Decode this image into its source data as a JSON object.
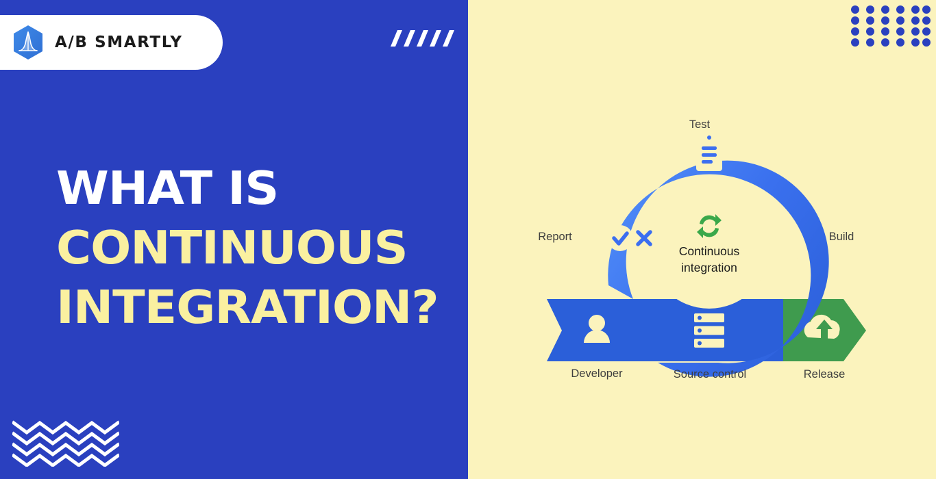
{
  "brand": {
    "name": "A/B SMARTLY",
    "logo_icon": "hexagon-bell-curve-icon",
    "accent_blue": "#2a40bf",
    "accent_yellow": "#faf0a0",
    "panel_cream": "#fbf3bd"
  },
  "decor": {
    "slashes_icon": "diagonal-slashes-decoration",
    "slashes_count": 5,
    "waves_icon": "zigzag-waves-decoration",
    "waves_count": 4,
    "dot_grid_icon": "dot-grid-decoration",
    "dot_grid_cols": 6,
    "dot_grid_rows": 4,
    "dot_color": "#2a40bf"
  },
  "headline": {
    "line1": "WHAT IS",
    "line2": "CONTINUOUS",
    "line3": "INTEGRATION?"
  },
  "diagram": {
    "center_line1": "Continuous",
    "center_line2": "integration",
    "center_icon": "refresh-cycle-icon",
    "center_icon_color": "#3aa84a",
    "stages": [
      {
        "label": "Test",
        "icon": "clipboard-icon",
        "color": "#3b6ef0"
      },
      {
        "label": "Build",
        "icon": "wrench-icon",
        "color": "#2a5fe0"
      },
      {
        "label": "Report",
        "icon": "check-and-x-icon",
        "color": "#4a84f5"
      },
      {
        "label": "Developer",
        "icon": "person-icon",
        "color": "#2b5fd9"
      },
      {
        "label": "Source control",
        "icon": "server-stack-icon",
        "color": "#2b5fd9"
      },
      {
        "label": "Release",
        "icon": "cloud-upload-icon",
        "color": "#3f9b4e"
      }
    ]
  }
}
